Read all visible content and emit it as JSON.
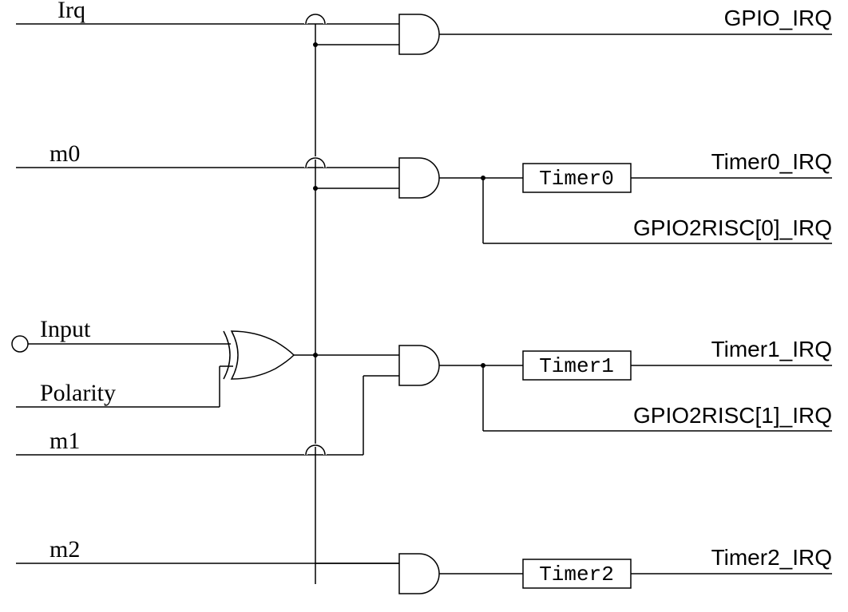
{
  "diagram": {
    "inputs": {
      "irq": {
        "label": "Irq"
      },
      "m0": {
        "label": "m0"
      },
      "input": {
        "label": "Input"
      },
      "polarity": {
        "label": "Polarity"
      },
      "m1": {
        "label": "m1"
      },
      "m2": {
        "label": "m2"
      }
    },
    "outputs": {
      "gpio_irq": {
        "label": "GPIO_IRQ"
      },
      "timer0_irq": {
        "label": "Timer0_IRQ"
      },
      "gpio2risc0_irq": {
        "label": "GPIO2RISC[0]_IRQ"
      },
      "timer1_irq": {
        "label": "Timer1_IRQ"
      },
      "gpio2risc1_irq": {
        "label": "GPIO2RISC[1]_IRQ"
      },
      "timer2_irq": {
        "label": "Timer2_IRQ"
      }
    },
    "blocks": {
      "timer0": {
        "label": "Timer0"
      },
      "timer1": {
        "label": "Timer1"
      },
      "timer2": {
        "label": "Timer2"
      }
    }
  },
  "chart_data": {
    "type": "logic-diagram",
    "signals_in": [
      "Irq",
      "m0",
      "Input",
      "Polarity",
      "m1",
      "m2"
    ],
    "signals_out": [
      "GPIO_IRQ",
      "Timer0_IRQ",
      "GPIO2RISC[0]_IRQ",
      "Timer1_IRQ",
      "GPIO2RISC[1]_IRQ",
      "Timer2_IRQ"
    ],
    "internal": {
      "X": "XOR(Input, Polarity)"
    },
    "gates": [
      {
        "kind": "XOR",
        "inputs": [
          "Input",
          "Polarity"
        ],
        "output": "X"
      },
      {
        "kind": "AND",
        "inputs": [
          "Irq",
          "X"
        ],
        "output": "GPIO_IRQ"
      },
      {
        "kind": "AND",
        "inputs": [
          "m0",
          "X"
        ],
        "output": "A0"
      },
      {
        "kind": "AND",
        "inputs": [
          "X",
          "m1"
        ],
        "output": "A1"
      },
      {
        "kind": "AND",
        "inputs": [
          "X",
          "m2"
        ],
        "output": "A2"
      }
    ],
    "timers": [
      {
        "name": "Timer0",
        "input": "A0",
        "output": "Timer0_IRQ"
      },
      {
        "name": "Timer1",
        "input": "A1",
        "output": "Timer1_IRQ"
      },
      {
        "name": "Timer2",
        "input": "A2",
        "output": "Timer2_IRQ"
      }
    ],
    "taps": [
      {
        "from": "A0",
        "to": "GPIO2RISC[0]_IRQ"
      },
      {
        "from": "A1",
        "to": "GPIO2RISC[1]_IRQ"
      }
    ]
  }
}
